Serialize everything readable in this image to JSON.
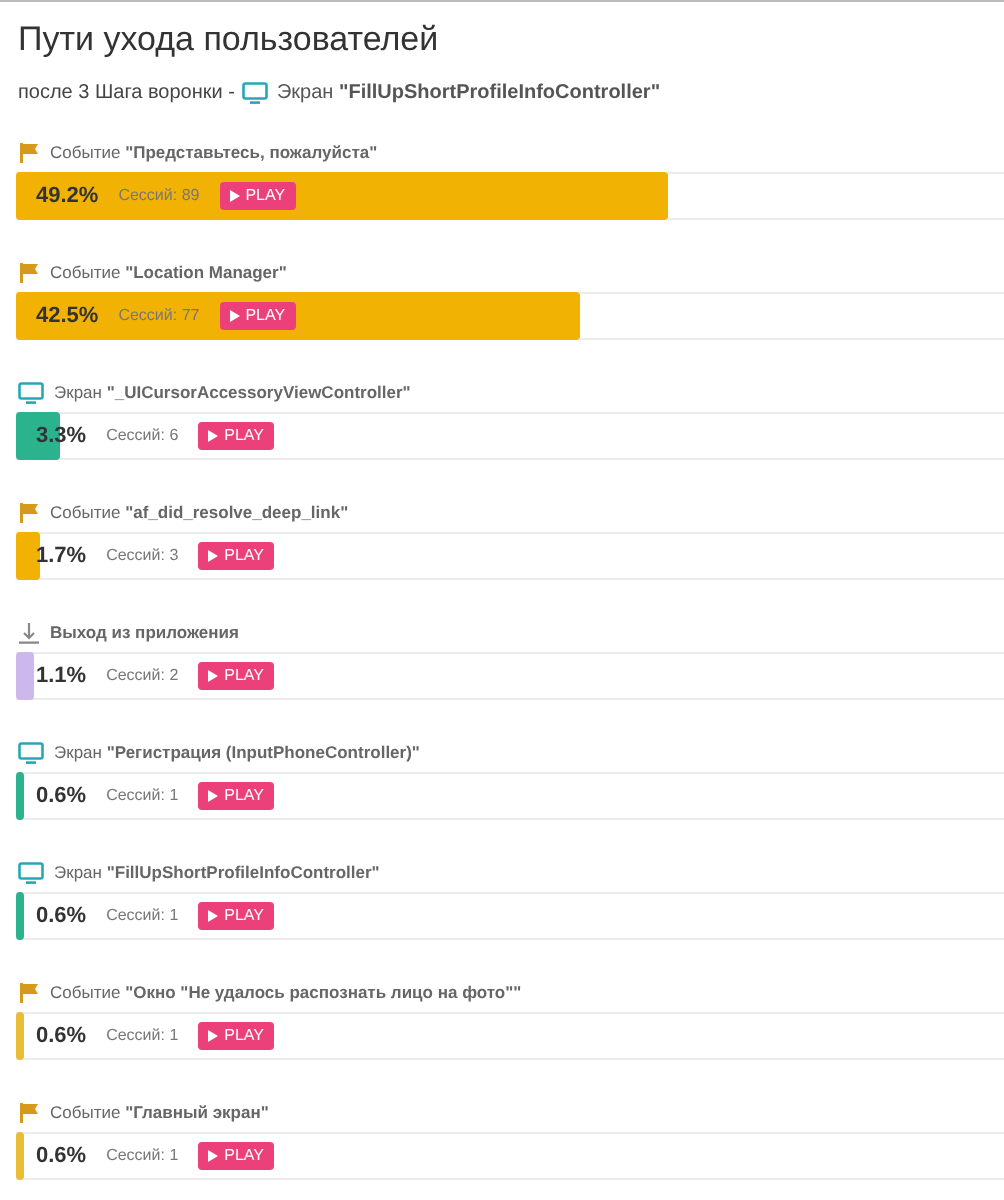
{
  "title": "Пути ухода пользователей",
  "subtitle": {
    "prefix": "после 3 Шага воронки -",
    "kind": "screen",
    "label": "Экран **\"FillUpShortProfileInfoController\"**"
  },
  "paths": [
    {
      "kind": "event",
      "label": "Событие **\"Представьтесь, пожалуйста\"**",
      "percent": "49.2%",
      "sessions": "Сессий: 89",
      "button": "PLAY",
      "level": 0.66,
      "color": "#f2b203"
    },
    {
      "kind": "event",
      "label": "Событие **\"Location Manager\"**",
      "percent": "42.5%",
      "sessions": "Сессий: 77",
      "button": "PLAY",
      "level": 0.57,
      "color": "#f2b203"
    },
    {
      "kind": "screen",
      "label": "Экран **\"_UICursorAccessoryViewController\"**",
      "percent": "3.3%",
      "sessions": "Сессий: 6",
      "button": "PLAY",
      "level": 0.045,
      "color": "#2bb38e"
    },
    {
      "kind": "event",
      "label": "Событие **\"af_did_resolve_deep_link\"**",
      "percent": "1.7%",
      "sessions": "Сессий: 3",
      "button": "PLAY",
      "level": 0.025,
      "color": "#f2b203"
    },
    {
      "kind": "exit",
      "label": "**Выход из приложения**",
      "percent": "1.1%",
      "sessions": "Сессий: 2",
      "button": "PLAY",
      "level": 0.018,
      "color": "#cdb8ee"
    },
    {
      "kind": "screen",
      "label": "Экран **\"Регистрация (InputPhoneController)\"**",
      "percent": "0.6%",
      "sessions": "Сессий: 1",
      "button": "PLAY",
      "level": 0.008,
      "color": "#2bb38e"
    },
    {
      "kind": "screen",
      "label": "Экран **\"FillUpShortProfileInfoController\"**",
      "percent": "0.6%",
      "sessions": "Сессий: 1",
      "button": "PLAY",
      "level": 0.008,
      "color": "#2bb38e"
    },
    {
      "kind": "event",
      "label": "Событие **\"Окно \"Не удалось распознать лицо на фото\"\"**",
      "percent": "0.6%",
      "sessions": "Сессий: 1",
      "button": "PLAY",
      "level": 0.008,
      "color": "#e9bd35"
    },
    {
      "kind": "event",
      "label": "Событие **\"Главный экран\"**",
      "percent": "0.6%",
      "sessions": "Сессий: 1",
      "button": "PLAY",
      "level": 0.008,
      "color": "#e9bd35"
    }
  ]
}
